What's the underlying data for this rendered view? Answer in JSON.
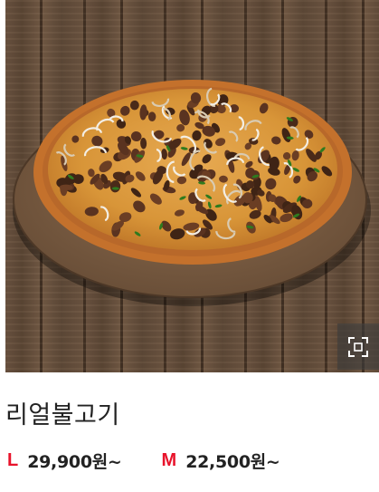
{
  "product": {
    "name": "리얼불고기",
    "image_alt": "pizza photo",
    "zoom_icon": "expand-icon",
    "prices": [
      {
        "size": "L",
        "price": "29,900원~"
      },
      {
        "size": "M",
        "price": "22,500원~"
      }
    ]
  },
  "colors": {
    "size_label": "#e8132b",
    "text": "#222222",
    "zoom_bg": "#3c3c3c",
    "wood": "#5f4a38",
    "crust": "#c9782f",
    "cheese": "#e3a34a"
  }
}
